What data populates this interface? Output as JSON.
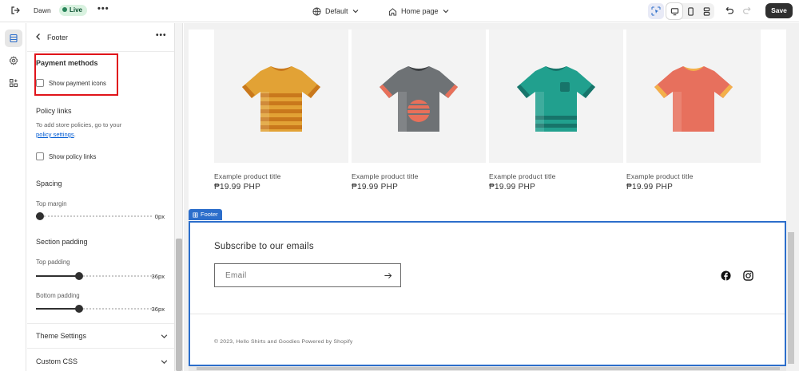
{
  "topbar": {
    "theme_name": "Dawn",
    "status": "Live",
    "template": "Default",
    "page": "Home page",
    "save_label": "Save"
  },
  "panel": {
    "title": "Footer",
    "payment": {
      "heading": "Payment methods",
      "checkbox_label": "Show payment icons"
    },
    "policy": {
      "heading": "Policy links",
      "help_text": "To add store policies, go to your",
      "help_link": "policy settings",
      "help_suffix": ".",
      "checkbox_label": "Show policy links"
    },
    "spacing": {
      "heading": "Spacing",
      "top_margin_label": "Top margin",
      "top_margin_value": "0px",
      "top_margin_fraction": 0.0
    },
    "padding": {
      "heading": "Section padding",
      "top_label": "Top padding",
      "top_value": "36px",
      "top_fraction": 0.36,
      "bottom_label": "Bottom padding",
      "bottom_value": "36px",
      "bottom_fraction": 0.36
    },
    "theme_settings": "Theme Settings",
    "custom_css": "Custom CSS"
  },
  "products": [
    {
      "title": "Example product title",
      "price": "₱19.99 PHP",
      "color": "#e2a235",
      "stripe": "#c9781c"
    },
    {
      "title": "Example product title",
      "price": "₱19.99 PHP",
      "color": "#6e7275",
      "stripe": "#e8705a"
    },
    {
      "title": "Example product title",
      "price": "₱19.99 PHP",
      "color": "#21a08e",
      "stripe": "#17746a"
    },
    {
      "title": "Example product title",
      "price": "₱19.99 PHP",
      "color": "#e7705d",
      "stripe": "#f3b04a"
    }
  ],
  "footer": {
    "tag": "Footer",
    "subscribe_title": "Subscribe to our emails",
    "email_placeholder": "Email",
    "copyright": "© 2023, Hello Shirts and Goodies Powered by Shopify"
  },
  "colors": {
    "accent": "#2c6ecb",
    "live": "#29845a",
    "highlight": "#e0141a"
  }
}
